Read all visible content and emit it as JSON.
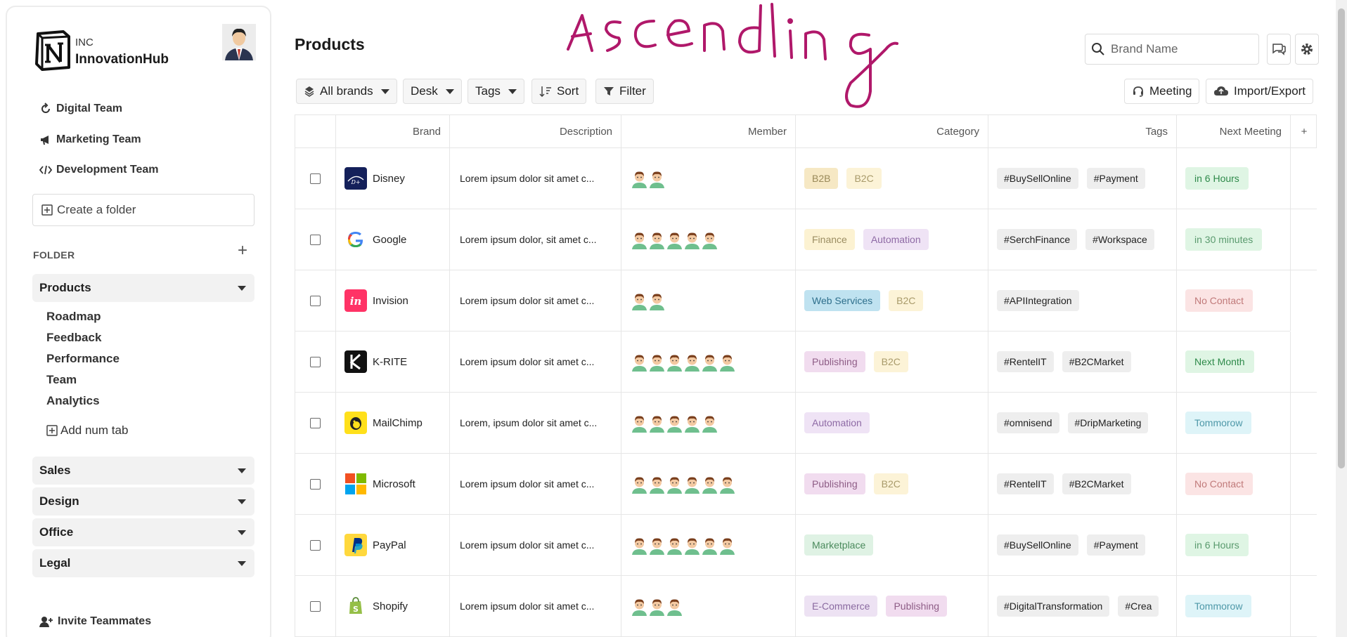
{
  "org": {
    "small": "INC",
    "name": "InnovationHub"
  },
  "teams": [
    {
      "label": "Digital Team",
      "icon": "refresh-icon"
    },
    {
      "label": "Marketing Team",
      "icon": "megaphone-icon"
    },
    {
      "label": "Development Team",
      "icon": "code-icon"
    }
  ],
  "create_folder": "Create a folder",
  "folder_label": "FOLDER",
  "folder_add": "+",
  "groups": {
    "products": "Products",
    "sales": "Sales",
    "design": "Design",
    "office": "Office",
    "legal": "Legal"
  },
  "sub_items": [
    "Roadmap",
    "Feedback",
    "Performance",
    "Team",
    "Analytics"
  ],
  "add_tab": "Add num tab",
  "invite": "Invite Teammates",
  "page_title": "Products",
  "annotation_text": "Ascending",
  "search": {
    "placeholder": "Brand Name"
  },
  "toolbar": {
    "all_brands": "All brands",
    "desk": "Desk",
    "tags": "Tags",
    "sort": "Sort",
    "filter": "Filter",
    "meeting": "Meeting",
    "import_export": "Import/Export"
  },
  "columns": [
    "Brand",
    "Description",
    "Member",
    "Category",
    "Tags",
    "Next Meeting",
    "+"
  ],
  "colors": {
    "b2b": "#f6e8c4",
    "b2c": "#fcf3d7",
    "finance": "#fcf2d2",
    "automation": "#efe3f5",
    "web_services": "#bfe2f0",
    "publishing": "#f1dcef",
    "marketplace": "#dff2e4",
    "ecommerce": "#ede2f3",
    "meet_green": "#dff5e4",
    "meet_red": "#fbe4e4",
    "meet_blue": "#def4f8"
  },
  "rows": [
    {
      "brand": "Disney",
      "logo": "disney-logo",
      "desc": "Lorem ipsum dolor sit amet c...",
      "members": 2,
      "categories": [
        {
          "label": "B2B",
          "bg": "#f6e8c4",
          "fg": "#9a8a5a"
        },
        {
          "label": "B2C",
          "bg": "#fcf3d7",
          "fg": "#a89a6a"
        }
      ],
      "tags": [
        "#BuySellOnline",
        "#Payment"
      ],
      "meeting": {
        "label": "in 6 Hours",
        "bg": "#dff5e4",
        "fg": "#2e8a4a"
      }
    },
    {
      "brand": "Google",
      "logo": "google-logo",
      "desc": "Lorem ipsum dolor, sit amet c...",
      "members": 5,
      "categories": [
        {
          "label": "Finance",
          "bg": "#fcf2d2",
          "fg": "#9b8d62"
        },
        {
          "label": "Automation",
          "bg": "#efe3f5",
          "fg": "#8e6aa5"
        }
      ],
      "tags": [
        "#SerchFinance",
        "#Workspace"
      ],
      "meeting": {
        "label": "in 30 minutes",
        "bg": "#dff5e4",
        "fg": "#5a9a6e"
      }
    },
    {
      "brand": "Invision",
      "logo": "invision-logo",
      "desc": "Lorem ipsum dolor sit amet c...",
      "members": 2,
      "categories": [
        {
          "label": "Web Services",
          "bg": "#bfe2f0",
          "fg": "#2e6f8c"
        },
        {
          "label": "B2C",
          "bg": "#fcf3d7",
          "fg": "#a89a6a"
        }
      ],
      "tags": [
        "#APIIntegration"
      ],
      "meeting": {
        "label": "No Contact",
        "bg": "#fbe4e4",
        "fg": "#c07a7a"
      }
    },
    {
      "brand": "K-RITE",
      "logo": "krite-logo",
      "desc": "Lorem ipsum dolor sit amet c...",
      "members": 6,
      "categories": [
        {
          "label": "Publishing",
          "bg": "#f1dcef",
          "fg": "#8e5d86"
        },
        {
          "label": "B2C",
          "bg": "#fcf3d7",
          "fg": "#a89a6a"
        }
      ],
      "tags": [
        "#RentelIT",
        "#B2CMarket"
      ],
      "meeting": {
        "label": "Next Month",
        "bg": "#dff5e4",
        "fg": "#2e8a4a"
      }
    },
    {
      "brand": "MailChimp",
      "logo": "mailchimp-logo",
      "desc": "Lorem, ipsum dolor sit amet c...",
      "members": 5,
      "categories": [
        {
          "label": "Automation",
          "bg": "#efe3f5",
          "fg": "#8e6aa5"
        }
      ],
      "tags": [
        "#omnisend",
        "#DripMarketing"
      ],
      "meeting": {
        "label": "Tommorow",
        "bg": "#def4f8",
        "fg": "#4e98a8"
      }
    },
    {
      "brand": "Microsoft",
      "logo": "microsoft-logo",
      "desc": "Lorem ipsum dolor sit amet c...",
      "members": 6,
      "categories": [
        {
          "label": "Publishing",
          "bg": "#f1dcef",
          "fg": "#8e5d86"
        },
        {
          "label": "B2C",
          "bg": "#fcf3d7",
          "fg": "#a89a6a"
        }
      ],
      "tags": [
        "#RentelIT",
        "#B2CMarket"
      ],
      "meeting": {
        "label": "No Contact",
        "bg": "#fbe4e4",
        "fg": "#c07a7a"
      }
    },
    {
      "brand": "PayPal",
      "logo": "paypal-logo",
      "desc": "Lorem ipsum dolor sit amet c...",
      "members": 6,
      "categories": [
        {
          "label": "Marketplace",
          "bg": "#dff2e4",
          "fg": "#4a8a5c"
        }
      ],
      "tags": [
        "#BuySellOnline",
        "#Payment"
      ],
      "meeting": {
        "label": "in 6 Hours",
        "bg": "#dff5e4",
        "fg": "#5a9a6e"
      }
    },
    {
      "brand": "Shopify",
      "logo": "shopify-logo",
      "desc": "Lorem ipsum dolor sit amet c...",
      "members": 3,
      "categories": [
        {
          "label": "E-Commerce",
          "bg": "#ede2f3",
          "fg": "#8a6aa0"
        },
        {
          "label": "Publishing",
          "bg": "#f1dcef",
          "fg": "#8e5d86"
        }
      ],
      "tags": [
        "#DigitalTransformation",
        "#Crea"
      ],
      "meeting": {
        "label": "Tommorow",
        "bg": "#def4f8",
        "fg": "#4e98a8"
      }
    }
  ]
}
